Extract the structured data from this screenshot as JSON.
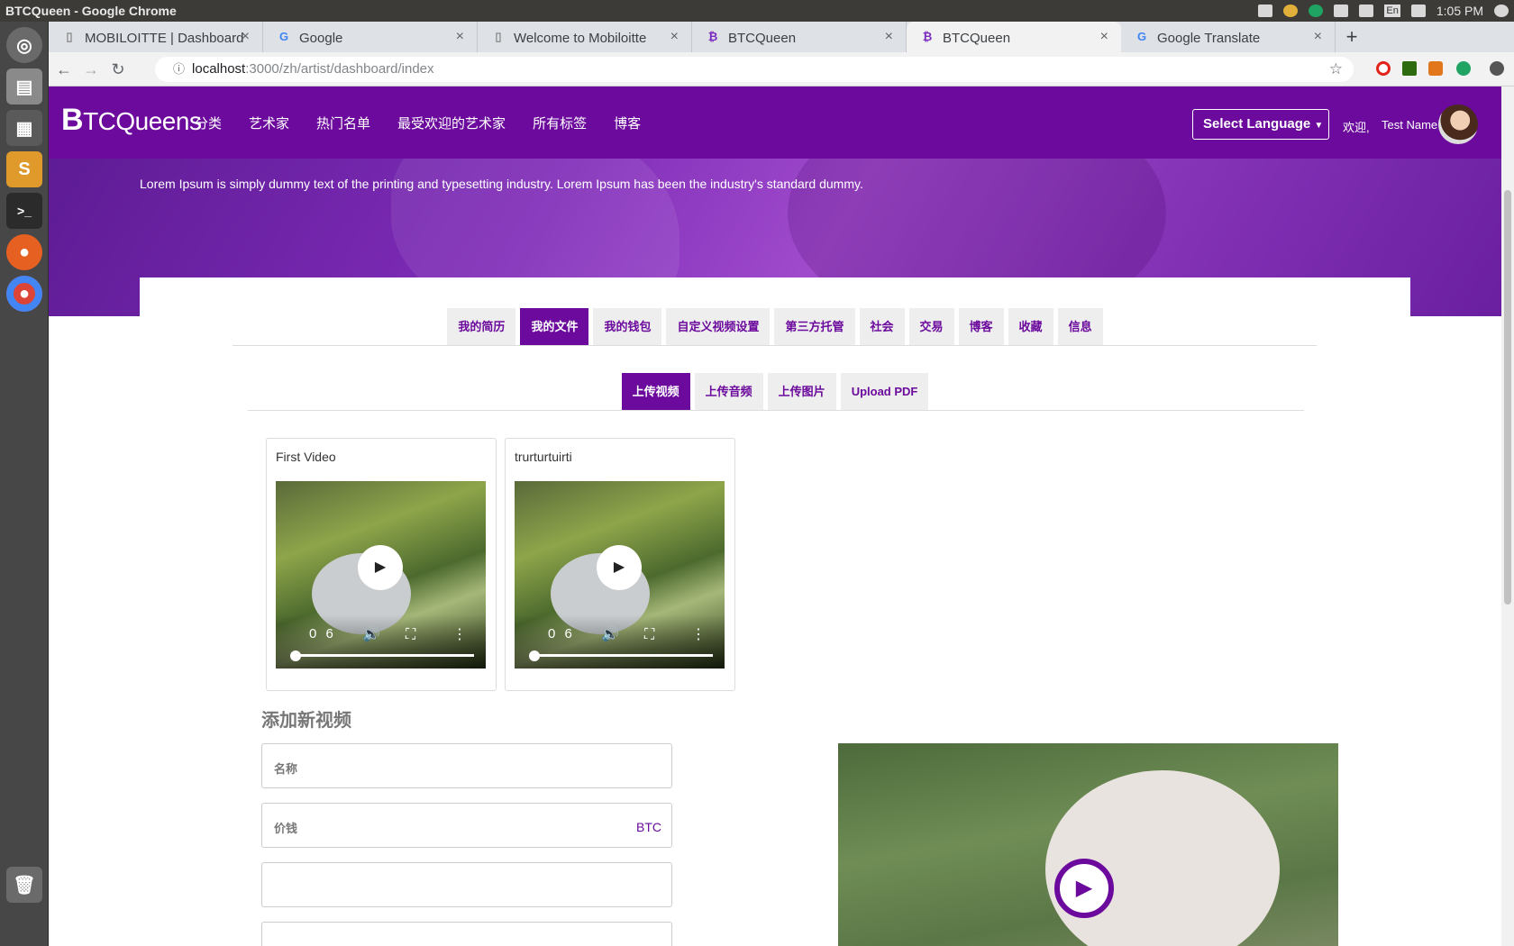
{
  "os": {
    "window_title": "BTCQueen - Google Chrome",
    "clock": "1:05 PM",
    "keyboard": "En"
  },
  "browser": {
    "tabs": [
      {
        "label": "MOBILOITTE | Dashboard"
      },
      {
        "label": "Google"
      },
      {
        "label": "Welcome to Mobiloitte"
      },
      {
        "label": "BTCQueen"
      },
      {
        "label": "BTCQueen"
      },
      {
        "label": "Google Translate"
      }
    ],
    "url_host": "localhost",
    "url_path": ":3000/zh/artist/dashboard/index"
  },
  "site": {
    "logo_b": "B",
    "logo_rest": "TCQueens",
    "menu": [
      "分类",
      "艺术家",
      "热门名单",
      "最受欢迎的艺术家",
      "所有标签",
      "博客"
    ],
    "language_button": "Select Language",
    "welcome": "欢迎,",
    "user_name": "Test Name",
    "hero_text": "Lorem Ipsum is simply dummy text of the printing and typesetting industry. Lorem Ipsum has been the industry's standard dummy."
  },
  "dashboard": {
    "main_tabs": [
      "我的简历",
      "我的文件",
      "我的钱包",
      "自定义视频设置",
      "第三方托管",
      "社会",
      "交易",
      "博客",
      "收藏",
      "信息"
    ],
    "active_main_tab": "我的文件",
    "sub_tabs": [
      "上传视频",
      "上传音频",
      "上传图片",
      "Upload PDF"
    ],
    "active_sub_tab": "上传视频",
    "videos": [
      {
        "title": "First Video",
        "time": "0 6"
      },
      {
        "title": "trurturtuirti",
        "time": "0 6"
      }
    ],
    "add_title": "添加新视频",
    "fields": {
      "name_label": "名称",
      "price_label": "价钱",
      "price_suffix": "BTC"
    }
  }
}
